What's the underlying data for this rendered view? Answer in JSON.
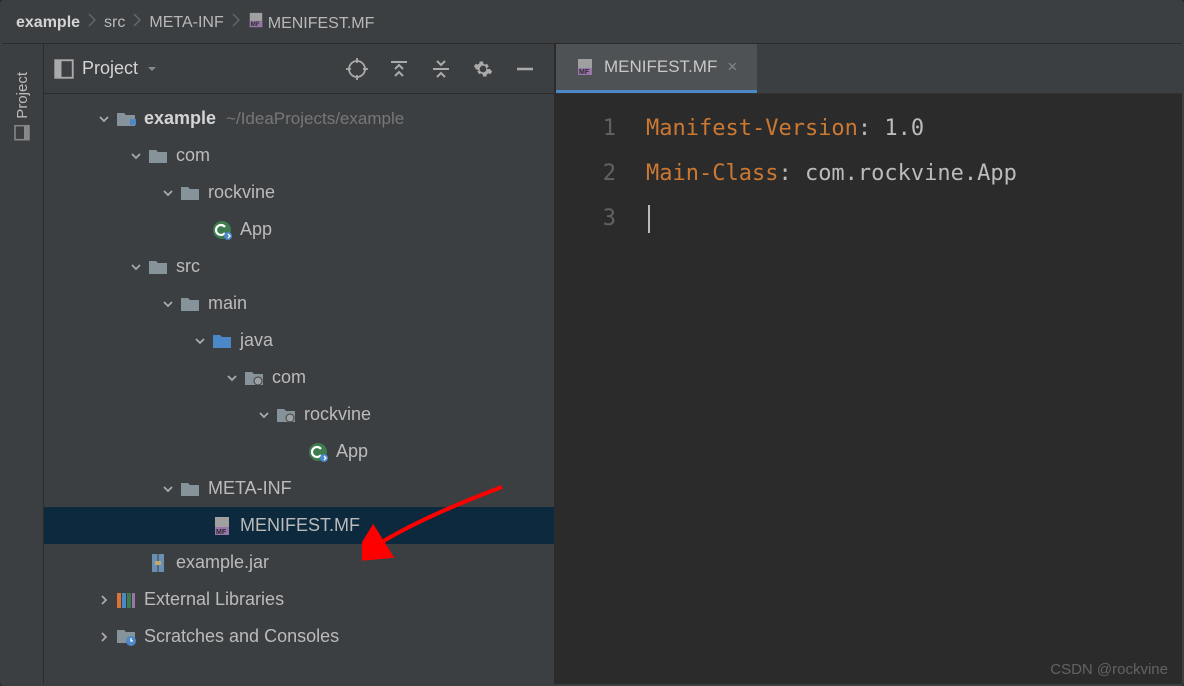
{
  "breadcrumb": [
    {
      "label": "example",
      "bold": true
    },
    {
      "label": "src"
    },
    {
      "label": "META-INF"
    },
    {
      "label": "MENIFEST.MF",
      "icon": "mf"
    }
  ],
  "sidebar": {
    "title": "Project",
    "vtab_label": "Project"
  },
  "tree": [
    {
      "depth": 0,
      "toggle": "down",
      "icon": "module",
      "label": "example",
      "bold": true,
      "hint": "~/IdeaProjects/example"
    },
    {
      "depth": 1,
      "toggle": "down",
      "icon": "folder",
      "label": "com"
    },
    {
      "depth": 2,
      "toggle": "down",
      "icon": "folder",
      "label": "rockvine"
    },
    {
      "depth": 3,
      "toggle": "",
      "icon": "class",
      "label": "App"
    },
    {
      "depth": 1,
      "toggle": "down",
      "icon": "folder",
      "label": "src"
    },
    {
      "depth": 2,
      "toggle": "down",
      "icon": "folder",
      "label": "main"
    },
    {
      "depth": 3,
      "toggle": "down",
      "icon": "folder-src",
      "label": "java"
    },
    {
      "depth": 4,
      "toggle": "down",
      "icon": "package",
      "label": "com"
    },
    {
      "depth": 5,
      "toggle": "down",
      "icon": "package",
      "label": "rockvine"
    },
    {
      "depth": 6,
      "toggle": "",
      "icon": "class",
      "label": "App"
    },
    {
      "depth": 2,
      "toggle": "down",
      "icon": "folder",
      "label": "META-INF"
    },
    {
      "depth": 3,
      "toggle": "",
      "icon": "mf",
      "label": "MENIFEST.MF",
      "selected": true
    },
    {
      "depth": 1,
      "toggle": "",
      "icon": "jar",
      "label": "example.jar"
    },
    {
      "depth": 0,
      "toggle": "right",
      "icon": "lib",
      "label": "External Libraries"
    },
    {
      "depth": 0,
      "toggle": "right",
      "icon": "scratch",
      "label": "Scratches and Consoles"
    }
  ],
  "tab": {
    "label": "MENIFEST.MF"
  },
  "code": {
    "lines": [
      "1",
      "2",
      "3"
    ],
    "l1_key": "Manifest-Version",
    "l1_val": ": 1.0",
    "l2_key": "Main-Class",
    "l2_val": ": com.rockvine.App"
  },
  "watermark": "CSDN @rockvine"
}
